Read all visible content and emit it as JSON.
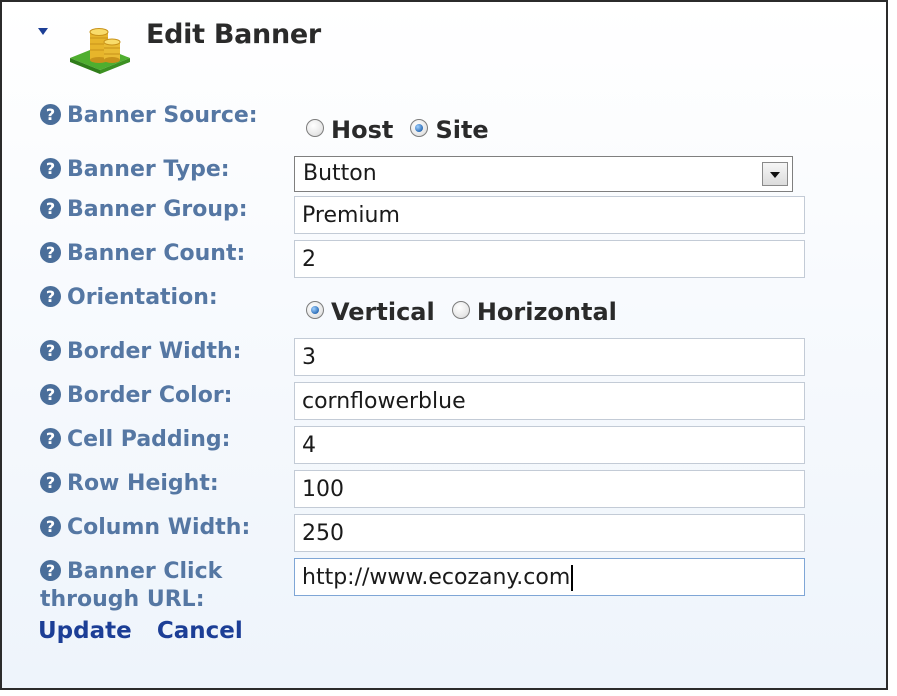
{
  "header": {
    "title": "Edit Banner",
    "collapse_icon": "triangle-down-icon",
    "module_icon": "coin-stack-icon"
  },
  "form": {
    "banner_source": {
      "label": "Banner Source:",
      "options": [
        {
          "label": "Host",
          "checked": false
        },
        {
          "label": "Site",
          "checked": true
        }
      ]
    },
    "banner_type": {
      "label": "Banner Type:",
      "value": "Button"
    },
    "banner_group": {
      "label": "Banner Group:",
      "value": "Premium"
    },
    "banner_count": {
      "label": "Banner Count:",
      "value": "2"
    },
    "orientation": {
      "label": "Orientation:",
      "options": [
        {
          "label": "Vertical",
          "checked": true
        },
        {
          "label": "Horizontal",
          "checked": false
        }
      ]
    },
    "border_width": {
      "label": "Border Width:",
      "value": "3"
    },
    "border_color": {
      "label": "Border Color:",
      "value": "cornflowerblue"
    },
    "cell_padding": {
      "label": "Cell Padding:",
      "value": "4"
    },
    "row_height": {
      "label": "Row Height:",
      "value": "100"
    },
    "column_width": {
      "label": "Column Width:",
      "value": "250"
    },
    "click_url": {
      "label": "Banner Click through URL:",
      "value": "http://www.ecozany.com"
    }
  },
  "actions": {
    "update_label": "Update",
    "cancel_label": "Cancel"
  },
  "colors": {
    "label": "#5577a3",
    "link": "#1c3e96",
    "help_icon": "#4a6e9a"
  },
  "icons": {
    "help": "question-circle-icon"
  }
}
